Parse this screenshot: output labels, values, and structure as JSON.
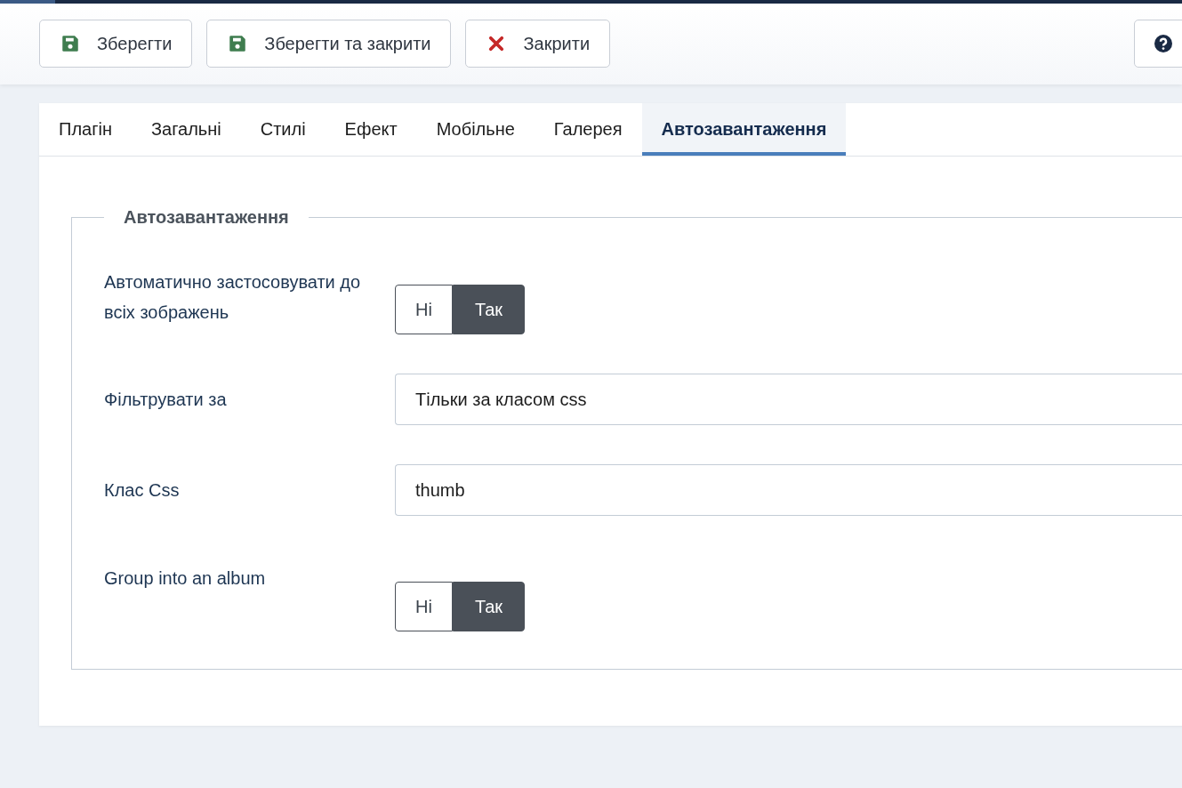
{
  "toolbar": {
    "buttons": [
      {
        "kind": "save",
        "label": "Зберегти"
      },
      {
        "kind": "save",
        "label": "Зберегти та закрити"
      },
      {
        "kind": "close",
        "label": "Закрити"
      }
    ],
    "help_button": {
      "kind": "help"
    }
  },
  "tabs": [
    {
      "label": "Плагін",
      "selected": false
    },
    {
      "label": "Загальні",
      "selected": false
    },
    {
      "label": "Стилі",
      "selected": false
    },
    {
      "label": "Ефект",
      "selected": false
    },
    {
      "label": "Мобільне",
      "selected": false
    },
    {
      "label": "Галерея",
      "selected": false
    },
    {
      "label": "Автозавантаження",
      "selected": true
    }
  ],
  "fieldset": {
    "legend": "Автозавантаження",
    "fields": [
      {
        "kind": "toggle",
        "label": "Автоматично застосовувати до всіх зображень",
        "options": [
          {
            "label": "Ні",
            "selected": false
          },
          {
            "label": "Так",
            "selected": true
          }
        ]
      },
      {
        "kind": "select",
        "label": "Фільтрувати за",
        "value": "Тільки за класом css"
      },
      {
        "kind": "text",
        "label": "Клас Css",
        "value": "thumb"
      },
      {
        "kind": "toggle",
        "label": "Group into an album",
        "options": [
          {
            "label": "Ні",
            "selected": false
          },
          {
            "label": "Так",
            "selected": true
          }
        ]
      }
    ]
  }
}
